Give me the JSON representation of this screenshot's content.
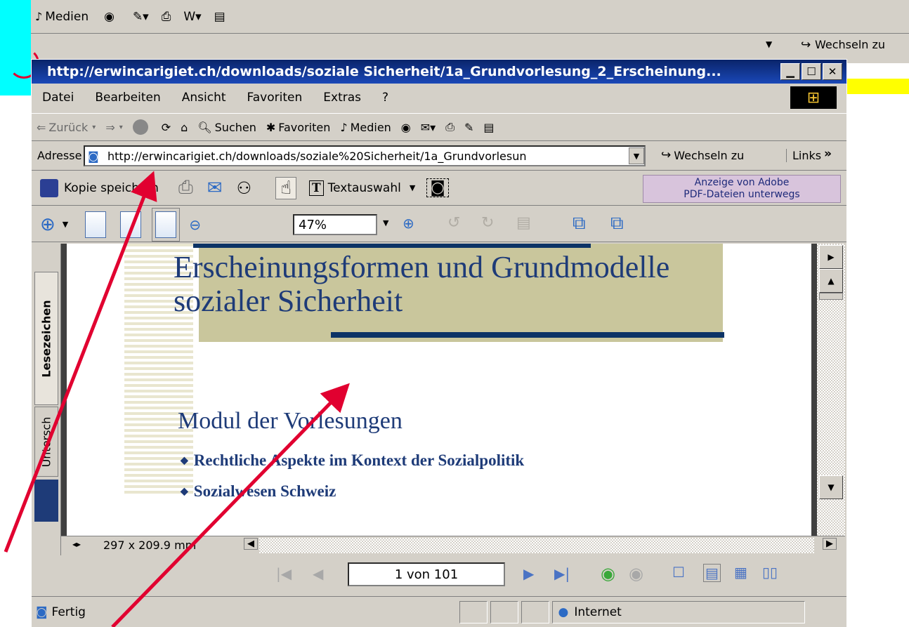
{
  "background_window": {
    "toolbar": {
      "media_label": "Medien"
    },
    "address": {
      "go_label": "Wechseln zu"
    }
  },
  "window": {
    "title": "http://erwincarigiet.ch/downloads/soziale Sicherheit/1a_Grundvorlesung_2_Erscheinung...",
    "menu": [
      "Datei",
      "Bearbeiten",
      "Ansicht",
      "Favoriten",
      "Extras",
      "?"
    ],
    "nav": {
      "back_label": "Zurück",
      "search_label": "Suchen",
      "favorites_label": "Favoriten",
      "media_label": "Medien"
    },
    "address": {
      "label": "Adresse",
      "url": "http://erwincarigiet.ch/downloads/soziale%20Sicherheit/1a_Grundvorlesun",
      "go_label": "Wechseln zu",
      "links_label": "Links"
    }
  },
  "pdf_toolbar": {
    "save_copy_label": "Kopie speichern",
    "text_select_label": "Textauswahl",
    "adobe_banner_line1": "Anzeige von Adobe",
    "adobe_banner_line2": "PDF-Dateien unterwegs",
    "zoom": "47%"
  },
  "side_tabs": {
    "bookmarks": "Lesezeichen",
    "signatures": "Untersch"
  },
  "document": {
    "title_line1": "Erscheinungsformen und Grundmodelle",
    "title_line2": "sozialer Sicherheit",
    "section_heading": "Modul der Vorlesungen",
    "bullets": [
      "Rechtliche Aspekte im Kontext der Sozialpolitik",
      "Sozialwesen Schweiz"
    ]
  },
  "page_size": "297 x 209.9 mm",
  "pager": {
    "page_display": "1 von 101"
  },
  "status": {
    "left": "Fertig",
    "zone": "Internet"
  },
  "colors": {
    "title_bar": "#0a246a",
    "annotation": "#e10030",
    "highlight": "#00ffff"
  }
}
